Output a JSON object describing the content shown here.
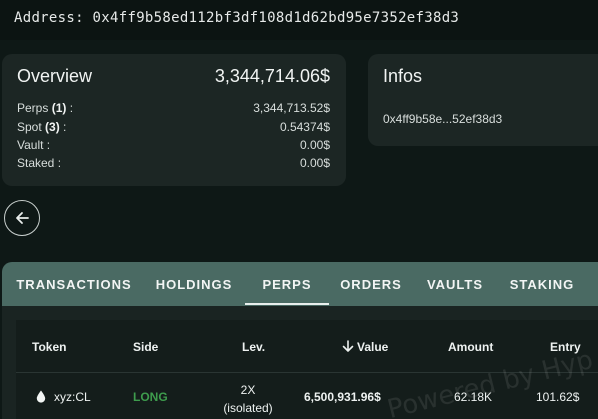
{
  "address_bar": {
    "text": "Address: 0x4ff9b58ed112bf3df108d1d62bd95e7352ef38d3"
  },
  "overview": {
    "title": "Overview",
    "total": "3,344,714.06$",
    "rows": [
      {
        "label": "Perps",
        "count": "(1)",
        "suffix": " :",
        "value": "3,344,713.52$"
      },
      {
        "label": "Spot",
        "count": "(3)",
        "suffix": " :",
        "value": "0.54374$"
      },
      {
        "label": "Vault :",
        "count": "",
        "suffix": "",
        "value": "0.00$"
      },
      {
        "label": "Staked :",
        "count": "",
        "suffix": "",
        "value": "0.00$"
      }
    ]
  },
  "infos": {
    "title": "Infos",
    "address_short": "0x4ff9b58e...52ef38d3"
  },
  "back_icon": "arrow-left-icon",
  "tabs": [
    {
      "label": "TRANSACTIONS",
      "active": false
    },
    {
      "label": "HOLDINGS",
      "active": false
    },
    {
      "label": "PERPS",
      "active": true
    },
    {
      "label": "ORDERS",
      "active": false
    },
    {
      "label": "VAULTS",
      "active": false
    },
    {
      "label": "STAKING",
      "active": false
    }
  ],
  "table": {
    "headers": {
      "token": "Token",
      "side": "Side",
      "lev": "Lev.",
      "value": "Value",
      "amount": "Amount",
      "entry": "Entry"
    },
    "sort_icon": "arrow-down-icon",
    "rows": [
      {
        "token": "xyz:CL",
        "side": "LONG",
        "lev": "2X",
        "lev_mode": "(isolated)",
        "value": "6,500,931.96$",
        "amount": "62.18K",
        "entry": "101.62$"
      }
    ]
  },
  "colors": {
    "long": "#3e9c4d",
    "tabs_bg": "#4a6a63",
    "card_bg": "#1c2624"
  },
  "watermark": "Powered by Hyp"
}
